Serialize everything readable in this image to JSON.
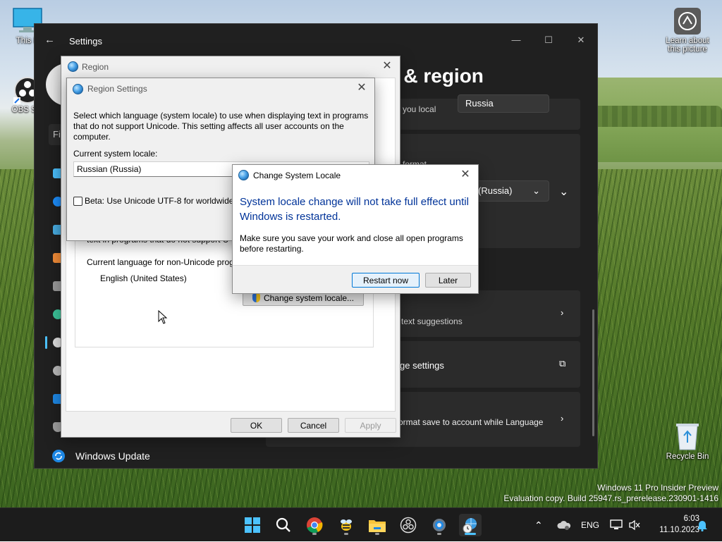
{
  "desktop": {
    "icons": [
      {
        "label": "This PC",
        "visible_label": "This P"
      },
      {
        "label": "OBS Studio",
        "visible_label": "OBS Stu"
      },
      {
        "label": "Learn about this picture"
      },
      {
        "label": "Recycle Bin"
      }
    ],
    "watermark": {
      "line1": "Windows 11 Pro Insider Preview",
      "line2": "Evaluation copy. Build 25947.rs_prerelease.230901-1416"
    }
  },
  "settings": {
    "title": "Settings",
    "heading": "e & region",
    "search_hint": "Fi",
    "cards": {
      "country_partial": "you local",
      "country_value": "Russia",
      "format_partial": "format",
      "format_value": "an (Russia)",
      "typing_partial": "text suggestions",
      "admin_partial": "ge settings",
      "sync_partial": "ormat save to account while Language"
    },
    "nav_windows_update": "Windows Update"
  },
  "region_dialog": {
    "title": "Region",
    "partial_text": "text in programs that do not support U",
    "current_lang_label": "Current language for non-Unicode prog",
    "current_lang_value": "English (United States)",
    "change_locale_button": "Change system locale...",
    "ok": "OK",
    "cancel": "Cancel",
    "apply": "Apply"
  },
  "region_settings": {
    "title": "Region Settings",
    "description": "Select which language (system locale) to use when displaying text in programs that do not support Unicode. This setting affects all user accounts on the computer.",
    "current_locale_label": "Current system locale:",
    "current_locale_value": "Russian (Russia)",
    "beta_label": "Beta: Use Unicode UTF-8 for worldwide"
  },
  "change_locale_dialog": {
    "title": "Change System Locale",
    "main_message": "System locale change will not take full effect until Windows is restarted.",
    "sub_message": "Make sure you save your work and close all open programs before restarting.",
    "restart_now": "Restart now",
    "later": "Later"
  },
  "taskbar": {
    "language": "ENG",
    "time": "6:03",
    "date": "11.10.2023"
  },
  "colors": {
    "accent": "#0078d7",
    "settings_bg": "#202020",
    "message_blue": "#003399",
    "taskbar_bg": "#1c1c1c"
  }
}
